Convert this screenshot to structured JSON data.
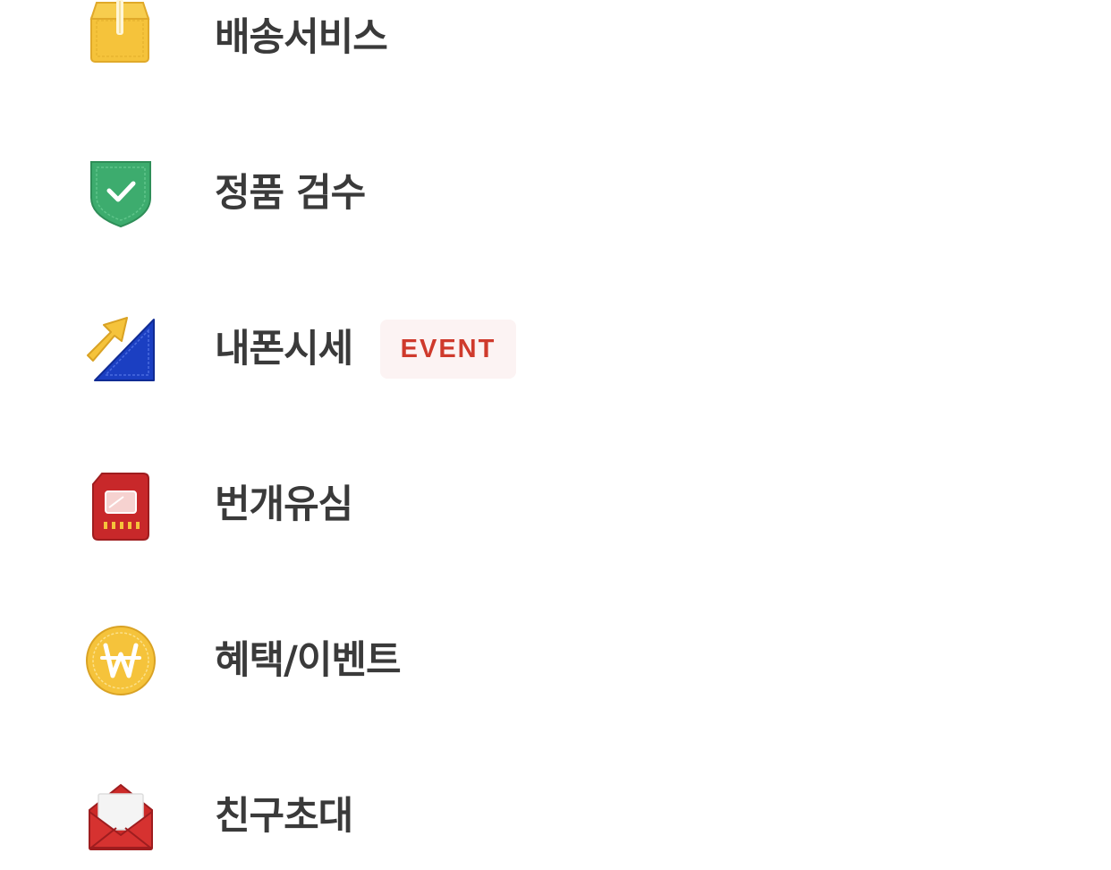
{
  "menu": {
    "items": [
      {
        "id": "delivery",
        "label": "배송서비스",
        "icon": "package-box-icon"
      },
      {
        "id": "authenticity",
        "label": "정품 검수",
        "icon": "shield-check-icon"
      },
      {
        "id": "phone-price",
        "label": "내폰시세",
        "icon": "signal-arrow-icon",
        "badge": "EVENT"
      },
      {
        "id": "usim",
        "label": "번개유심",
        "icon": "sim-card-icon"
      },
      {
        "id": "benefits",
        "label": "혜택/이벤트",
        "icon": "won-coin-icon"
      },
      {
        "id": "invite",
        "label": "친구초대",
        "icon": "envelope-icon"
      }
    ]
  },
  "colors": {
    "label_text": "#3a3a3a",
    "badge_text": "#cf3a2c",
    "badge_bg": "#fcf3f3",
    "box_yellow": "#f5c33b",
    "shield_green": "#3dac6e",
    "signal_blue": "#1b3fc2",
    "arrow_yellow": "#f5c33b",
    "sim_red": "#c8282a",
    "coin_yellow": "#f5c33b",
    "envelope_red": "#cc2a28"
  }
}
